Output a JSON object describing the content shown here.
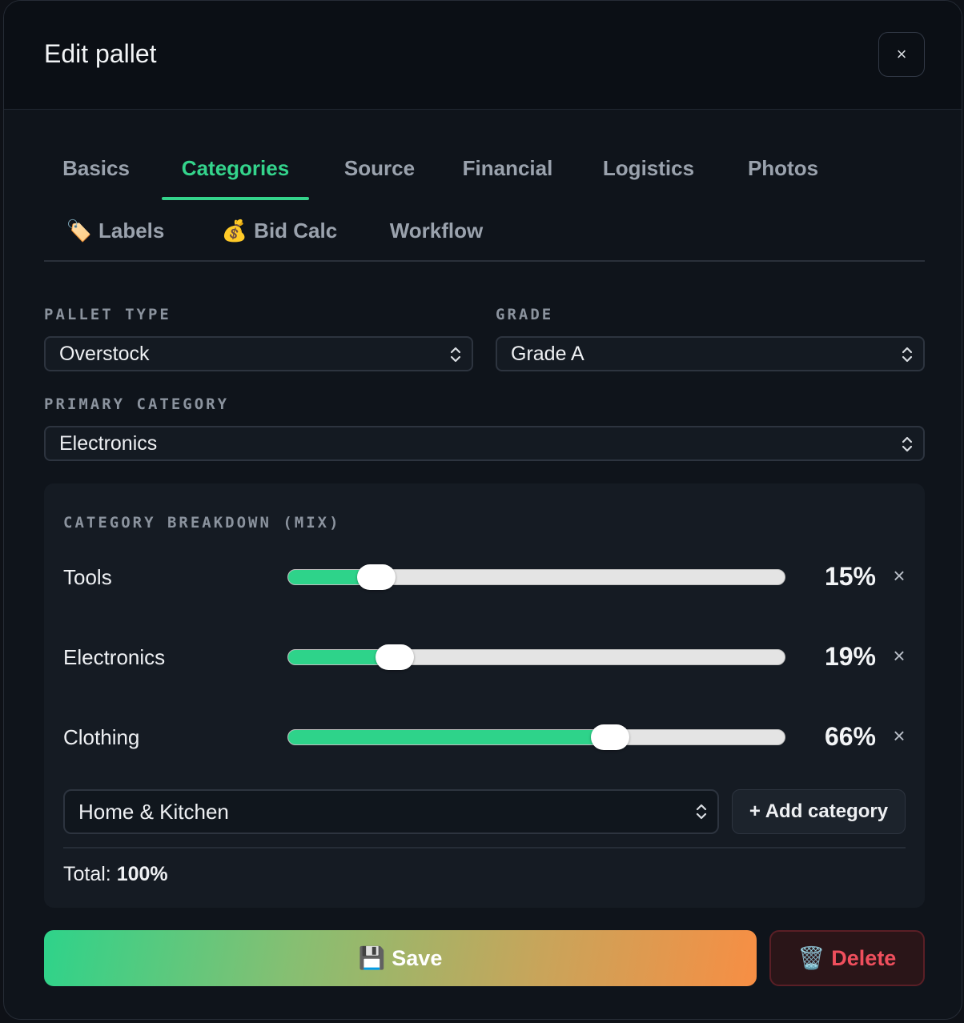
{
  "dialog": {
    "title": "Edit pallet",
    "close_label": "×"
  },
  "tabs": [
    {
      "label": "Basics",
      "icon": "",
      "active": false
    },
    {
      "label": "Categories",
      "icon": "",
      "active": true
    },
    {
      "label": "Source",
      "icon": "",
      "active": false
    },
    {
      "label": "Financial",
      "icon": "",
      "active": false
    },
    {
      "label": "Logistics",
      "icon": "",
      "active": false
    },
    {
      "label": "Photos",
      "icon": "",
      "active": false
    },
    {
      "label": "Labels",
      "icon": "🏷️",
      "active": false
    },
    {
      "label": "Bid Calc",
      "icon": "💰",
      "active": false
    },
    {
      "label": "Workflow",
      "icon": "",
      "active": false
    }
  ],
  "fields": {
    "pallet_type": {
      "label": "PALLET TYPE",
      "value": "Overstock"
    },
    "grade": {
      "label": "GRADE",
      "value": "Grade A"
    },
    "primary_category": {
      "label": "PRIMARY CATEGORY",
      "value": "Electronics"
    }
  },
  "mix": {
    "title": "CATEGORY BREAKDOWN (MIX)",
    "rows": [
      {
        "name": "Tools",
        "percent": 15,
        "percent_label": "15%",
        "remove": "×"
      },
      {
        "name": "Electronics",
        "percent": 19,
        "percent_label": "19%",
        "remove": "×"
      },
      {
        "name": "Clothing",
        "percent": 66,
        "percent_label": "66%",
        "remove": "×"
      }
    ],
    "add_select_value": "Home & Kitchen",
    "add_button_label": "+ Add category",
    "total_label": "Total:",
    "total_value": "100%"
  },
  "actions": {
    "save_icon": "💾",
    "save_label": "Save",
    "delete_icon": "🗑️",
    "delete_label": "Delete"
  },
  "colors": {
    "accent": "#34d48c",
    "danger": "#ef4f5d",
    "background": "#0f141b"
  }
}
